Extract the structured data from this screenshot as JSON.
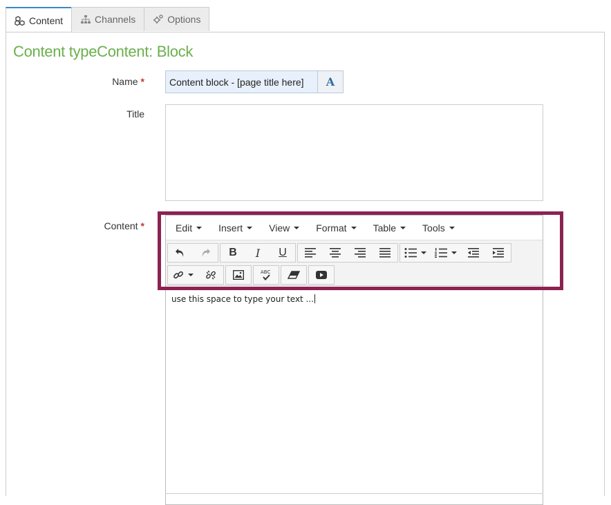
{
  "tabs": [
    {
      "label": "Content",
      "icon": "cubes-icon",
      "active": true
    },
    {
      "label": "Channels",
      "icon": "sitemap-icon",
      "active": false
    },
    {
      "label": "Options",
      "icon": "cogs-icon",
      "active": false
    }
  ],
  "page": {
    "title": "Content typeContent: Block"
  },
  "form": {
    "name_label": "Name",
    "name_value": "Content block - [page title here]",
    "title_label": "Title",
    "title_value": "",
    "content_label": "Content",
    "required_mark": "*"
  },
  "editor": {
    "menus": [
      "Edit",
      "Insert",
      "View",
      "Format",
      "Table",
      "Tools"
    ],
    "body_text": "use this space to type your text ..."
  },
  "colors": {
    "accent": "#6ab04c",
    "highlight": "#8b2252",
    "required": "#c0392b",
    "tab_active": "#3a87c8"
  }
}
